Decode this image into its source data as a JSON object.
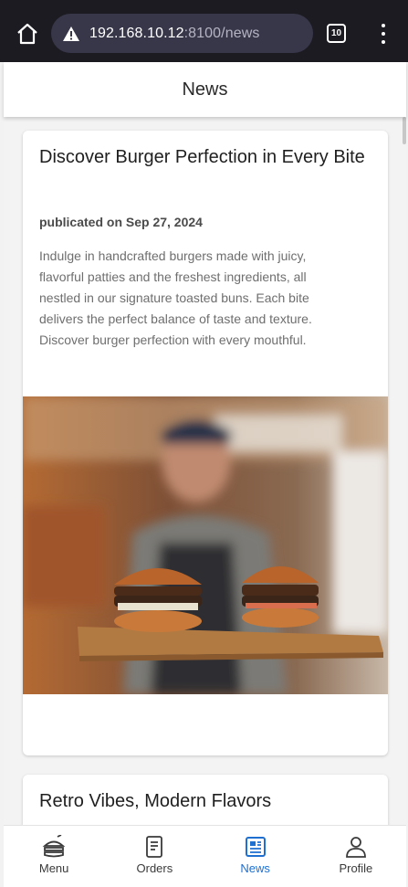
{
  "browser": {
    "url_host": "192.168.10.12",
    "url_path": ":8100/news",
    "tab_count": "10"
  },
  "app_bar": {
    "title": "News"
  },
  "articles": [
    {
      "title": "Discover Burger Perfection in Every Bite",
      "date": "publicated on Sep 27, 2024",
      "body": "Indulge in handcrafted burgers made with juicy, flavorful patties and the freshest ingredients, all nestled in our signature toasted buns. Each bite delivers the perfect balance of taste and texture. Discover burger perfection with every mouthful."
    },
    {
      "title": "Retro Vibes, Modern Flavors"
    }
  ],
  "nav": {
    "items": [
      {
        "label": "Menu",
        "icon": "burger-icon"
      },
      {
        "label": "Orders",
        "icon": "receipt-icon"
      },
      {
        "label": "News",
        "icon": "newspaper-icon",
        "active": true
      },
      {
        "label": "Profile",
        "icon": "person-icon"
      }
    ]
  },
  "colors": {
    "accent": "#1e6fd0",
    "browser_bg": "#1c1b22",
    "url_pill": "#38374a"
  }
}
